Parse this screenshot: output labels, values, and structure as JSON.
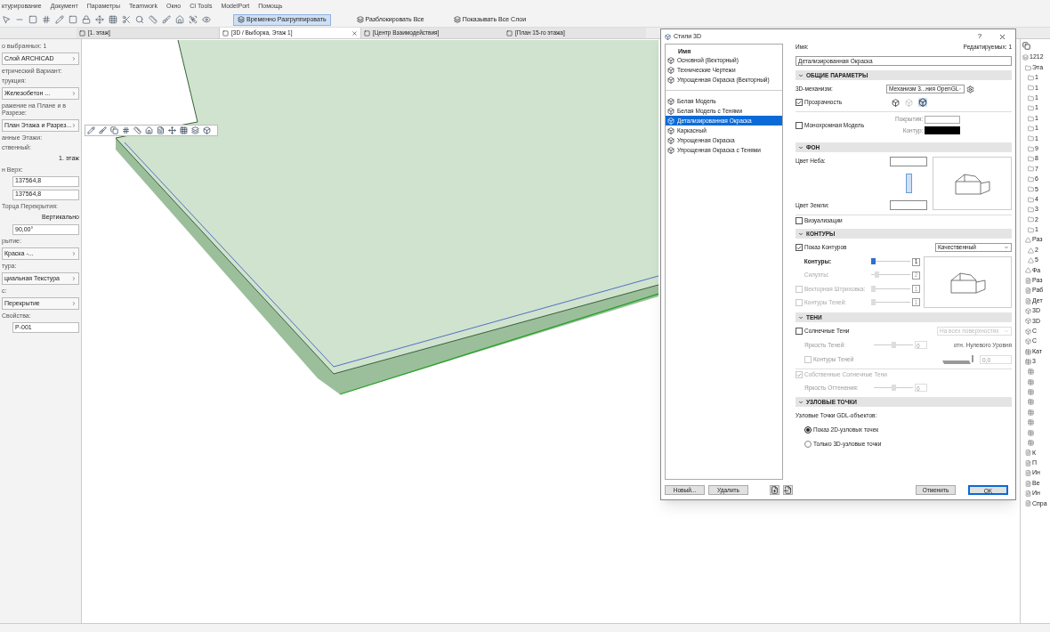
{
  "menu": [
    "ктурирование",
    "Документ",
    "Параметры",
    "Teamwork",
    "Окно",
    "CI Tools",
    "ModelPort",
    "Помощь"
  ],
  "toolbar_buttons": [
    {
      "label": "Временно Разгруппировать",
      "selected": true
    },
    {
      "label": "Разблокировать Все",
      "selected": false
    },
    {
      "label": "Показывать Все Слои",
      "selected": false
    }
  ],
  "tabs": [
    {
      "label": "[1. этаж]",
      "selected": false
    },
    {
      "label": "[3D / Выборка, Этаж 1]",
      "selected": true
    },
    {
      "label": "[Центр Взаимодействия]",
      "selected": false
    },
    {
      "label": "[План 15-го этажа]",
      "selected": false
    }
  ],
  "info_box": [
    {
      "kind": "label",
      "text": "о выбранных: 1"
    },
    {
      "kind": "select",
      "text": "Слой ARCHICAD"
    },
    {
      "kind": "label",
      "text": "етрический Вариант:"
    },
    {
      "kind": "label",
      "text": "трукция:"
    },
    {
      "kind": "select",
      "text": "Железобетон ..."
    },
    {
      "kind": "label",
      "text": "ражение на Плане и в Разрезе:"
    },
    {
      "kind": "select",
      "text": "План Этажа и Разрез..."
    },
    {
      "kind": "label",
      "text": "анные Этажи:"
    },
    {
      "kind": "label",
      "text": "ственный:"
    },
    {
      "kind": "value",
      "text": "1. этаж"
    },
    {
      "kind": "label",
      "text": "н Верх:"
    },
    {
      "kind": "field",
      "text": "137564,8"
    },
    {
      "kind": "field",
      "text": "137564,8"
    },
    {
      "kind": "label",
      "text": "Торца Перекрытия:"
    },
    {
      "kind": "value",
      "text": "Вертикально"
    },
    {
      "kind": "field",
      "text": "90,00°"
    },
    {
      "kind": "label",
      "text": "рытие:"
    },
    {
      "kind": "select",
      "text": "Краска -..."
    },
    {
      "kind": "label",
      "text": "тура:"
    },
    {
      "kind": "select",
      "text": "циальная Текстура"
    },
    {
      "kind": "label",
      "text": "с:"
    },
    {
      "kind": "select",
      "text": "Перекрытие"
    },
    {
      "kind": "label",
      "text": "Свойства:"
    },
    {
      "kind": "field",
      "text": "P-001"
    }
  ],
  "dialog": {
    "title": "Стили 3D",
    "help": "?",
    "list_header": "Имя",
    "style_groups": [
      [
        {
          "label": "Основной (Векторный)",
          "selected": false
        },
        {
          "label": "Технические Чертежи",
          "selected": false
        },
        {
          "label": "Упрощенная Окраска (Векторный)",
          "selected": false
        }
      ],
      [
        {
          "label": "Белая Модель",
          "selected": false
        },
        {
          "label": "Белая Модель с Тенями",
          "selected": false
        },
        {
          "label": "Детализированная Окраска",
          "selected": true
        },
        {
          "label": "Каркасный",
          "selected": false
        },
        {
          "label": "Упрощенная Окраска",
          "selected": false
        },
        {
          "label": "Упрощенная Окраска с Тенями",
          "selected": false
        }
      ]
    ],
    "name_label": "Имя:",
    "editable": "Редактируемых: 1",
    "name_value": "Детализированная Окраска",
    "general": {
      "title": "ОБЩИЕ ПАРАМЕТРЫ",
      "expanded": true,
      "engine_label": "3D-механизм:",
      "engine_value": "Механизм 3...ния OpenGL",
      "transparency": {
        "label": "Прозрачность",
        "checked": true
      },
      "mono": {
        "label": "Монохромная Модель",
        "checked": false
      },
      "surface_label": "Покрытия:",
      "contour_label": "Контур:"
    },
    "background": {
      "title": "ФОН",
      "expanded": true,
      "sky_label": "Цвет Неба:",
      "ground_label": "Цвет Земли:"
    },
    "visualization": {
      "label": "Визуализации",
      "checked": false
    },
    "contours": {
      "title": "КОНТУРЫ",
      "expanded": true,
      "show": {
        "label": "Показ Контуров",
        "checked": true
      },
      "mode": "Качественный",
      "sliders": [
        {
          "kind": "plain",
          "label": "Контуры:",
          "disabled": false,
          "level": 0.0,
          "value": "1"
        },
        {
          "kind": "plain",
          "label": "Силуэты:",
          "disabled": true,
          "level": 0.1,
          "value": "2"
        },
        {
          "kind": "checkbox",
          "label": "Векторная Штриховка:",
          "checked": false,
          "disabled": true,
          "level": 0.0,
          "value": "1"
        },
        {
          "kind": "checkbox",
          "label": "Контуры Теней:",
          "checked": false,
          "disabled": true,
          "level": 0.0,
          "value": "1"
        }
      ]
    },
    "shadows": {
      "title": "ТЕНИ",
      "expanded": true,
      "sun": {
        "label": "Солнечные Тени",
        "checked": false
      },
      "sun_mode": "На всех поверхностях",
      "brightness": {
        "label": "Яркость Теней:",
        "level": 0.5,
        "value": "0"
      },
      "relative_label": "отн. Нулевого Уровня",
      "shadow_contours": {
        "label": "Контуры Теней",
        "checked": false
      },
      "height_value": "0,0",
      "own": {
        "label": "Собственные Солнечные Тени",
        "checked": true
      },
      "shade": {
        "label": "Яркость Оттенения:",
        "level": 0.5,
        "value": "0"
      }
    },
    "nodes": {
      "title": "УЗЛОВЫЕ ТОЧКИ",
      "expanded": true,
      "label": "Узловые Точки GDL-объектов:",
      "options": [
        {
          "label": "Показ 2D-узловых точек",
          "selected": true
        },
        {
          "label": "Только 3D-узловые точки",
          "selected": false
        }
      ]
    },
    "new_button": "Новый...",
    "delete_button": "Удалить",
    "cancel_button": "Отменить",
    "ok_button": "OK"
  },
  "navigator": [
    {
      "kind": "root",
      "label": "1212",
      "children": [
        {
          "kind": "folder",
          "label": "Эта",
          "children": [
            {
              "kind": "folder",
              "label": "1"
            },
            {
              "kind": "folder",
              "label": "1"
            },
            {
              "kind": "folder",
              "label": "1"
            },
            {
              "kind": "folder",
              "label": "1"
            },
            {
              "kind": "folder",
              "label": "1"
            },
            {
              "kind": "folder",
              "label": "1"
            },
            {
              "kind": "folder",
              "label": "1"
            },
            {
              "kind": "folder",
              "label": "9"
            },
            {
              "kind": "folder",
              "label": "8"
            },
            {
              "kind": "folder",
              "label": "7"
            },
            {
              "kind": "folder",
              "label": "6"
            },
            {
              "kind": "folder",
              "label": "5"
            },
            {
              "kind": "folder",
              "label": "4"
            },
            {
              "kind": "folder",
              "label": "3"
            },
            {
              "kind": "folder",
              "label": "2"
            },
            {
              "kind": "folder",
              "label": "1"
            }
          ]
        },
        {
          "kind": "section",
          "label": "Раз",
          "children": [
            {
              "kind": "section",
              "label": "2"
            },
            {
              "kind": "section",
              "label": "5"
            }
          ]
        },
        {
          "kind": "section",
          "label": "Фа"
        },
        {
          "kind": "sheet",
          "label": "Раз"
        },
        {
          "kind": "sheet",
          "label": "Раб"
        },
        {
          "kind": "sheet",
          "label": "Дет"
        },
        {
          "kind": "cube",
          "label": "3D"
        },
        {
          "kind": "cube",
          "label": "3D"
        },
        {
          "kind": "cube",
          "label": "С"
        },
        {
          "kind": "cube",
          "label": "С"
        },
        {
          "kind": "table",
          "label": "Кат"
        },
        {
          "kind": "table",
          "label": "3",
          "children": [
            {
              "kind": "table"
            },
            {
              "kind": "table"
            },
            {
              "kind": "table"
            },
            {
              "kind": "table"
            },
            {
              "kind": "table"
            },
            {
              "kind": "table"
            },
            {
              "kind": "table"
            },
            {
              "kind": "table"
            }
          ]
        },
        {
          "kind": "sheet",
          "label": "К"
        },
        {
          "kind": "sheet",
          "label": "П"
        },
        {
          "kind": "sheet",
          "label": "Ин"
        },
        {
          "kind": "sheet",
          "label": "Ве"
        },
        {
          "kind": "sheet",
          "label": "Ин"
        },
        {
          "kind": "sheet",
          "label": "Спра"
        }
      ]
    }
  ]
}
